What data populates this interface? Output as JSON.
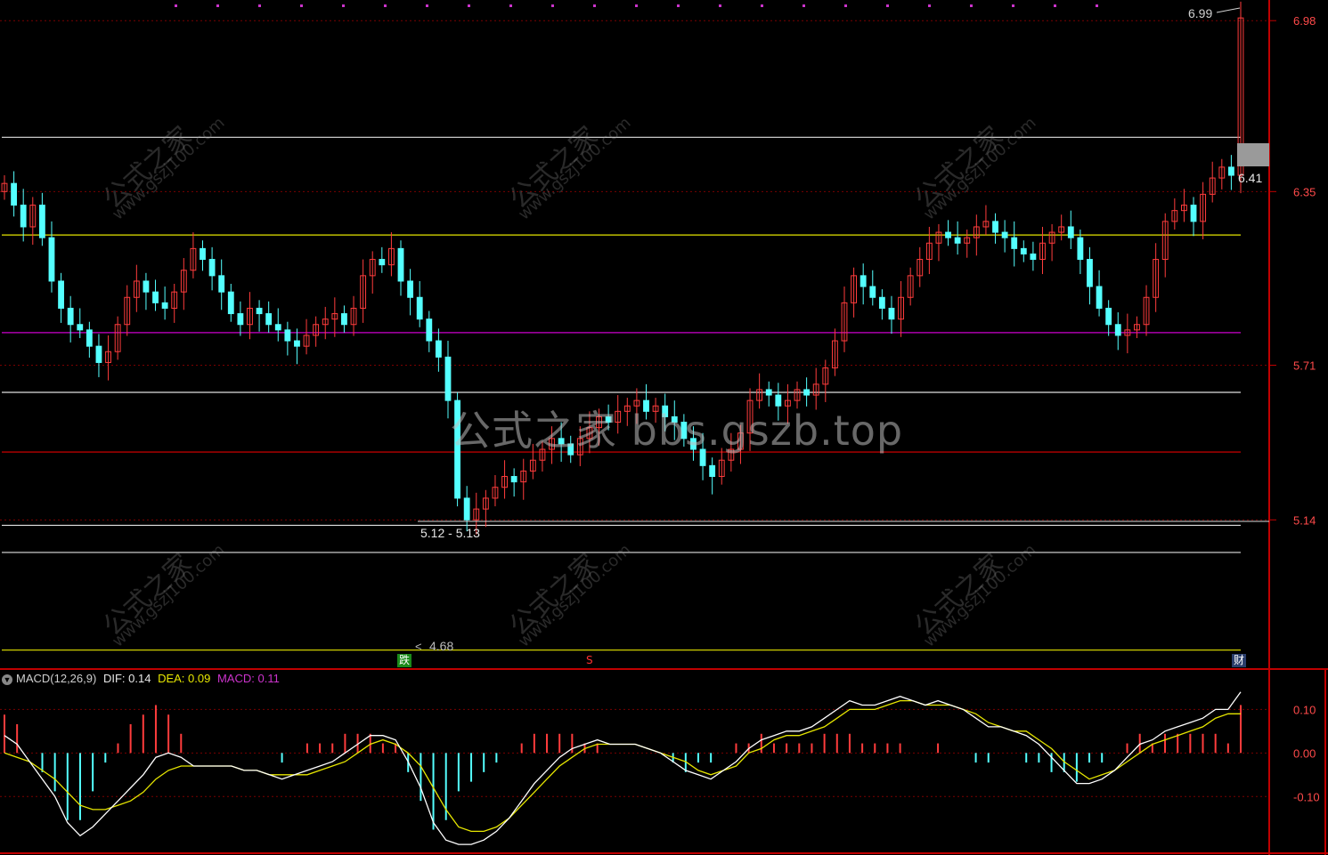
{
  "indicator": {
    "name": "MACD(12,26,9)",
    "dif_label": "DIF:",
    "dif_value": "0.14",
    "dea_label": "DEA:",
    "dea_value": "0.09",
    "macd_label": "MACD:",
    "macd_value": "0.11"
  },
  "watermark": {
    "main": "公式之家 bbs.gszb.top",
    "brand": "公式之家",
    "url": "www.gszj100.com"
  },
  "badges": {
    "drop": "跌",
    "s_mark": "S",
    "finance": "财"
  },
  "colors": {
    "up": "#ff3c3c",
    "down": "#54ffff",
    "axis": "#c00000",
    "grid": "#7a0000",
    "white_line": "#e0e0e0",
    "yellow_line": "#e6e600",
    "purple_line": "#cc00cc",
    "red_line": "#e00000",
    "dif": "#ffffff",
    "dea": "#e6e600"
  },
  "chart_data": {
    "type": "candlestick",
    "price_axis": {
      "ticks": [
        "6.98",
        "6.35",
        "5.71",
        "5.14"
      ],
      "range": [
        4.6,
        7.02
      ]
    },
    "macd_axis": {
      "ticks": [
        "0.10",
        "0.00",
        "-0.10"
      ],
      "range": [
        -0.22,
        0.16
      ]
    },
    "annotations": {
      "high_label": "6.99",
      "last_label": "6.41",
      "gap_label": "5.12 - 5.13",
      "low_label": "4.68"
    },
    "horizontal_lines": [
      {
        "price": 6.55,
        "color": "white_line"
      },
      {
        "price": 6.19,
        "color": "yellow_line"
      },
      {
        "price": 5.83,
        "color": "purple_line"
      },
      {
        "price": 5.61,
        "color": "white_line"
      },
      {
        "price": 5.39,
        "color": "red_line"
      },
      {
        "price": 5.12,
        "color": "white_line"
      },
      {
        "price": 5.02,
        "color": "white_line"
      },
      {
        "price": 4.66,
        "color": "yellow_line"
      }
    ],
    "close_series": [
      6.38,
      6.3,
      6.22,
      6.3,
      6.18,
      6.02,
      5.92,
      5.86,
      5.84,
      5.78,
      5.72,
      5.76,
      5.86,
      5.96,
      6.02,
      5.98,
      5.94,
      5.92,
      5.98,
      6.06,
      6.14,
      6.1,
      6.04,
      5.98,
      5.9,
      5.86,
      5.92,
      5.9,
      5.86,
      5.84,
      5.8,
      5.78,
      5.82,
      5.86,
      5.88,
      5.9,
      5.86,
      5.92,
      6.04,
      6.1,
      6.08,
      6.14,
      6.02,
      5.96,
      5.88,
      5.8,
      5.74,
      5.58,
      5.22,
      5.14,
      5.18,
      5.22,
      5.26,
      5.3,
      5.28,
      5.32,
      5.36,
      5.4,
      5.44,
      5.42,
      5.38,
      5.44,
      5.48,
      5.52,
      5.5,
      5.54,
      5.56,
      5.58,
      5.54,
      5.56,
      5.52,
      5.5,
      5.44,
      5.4,
      5.34,
      5.3,
      5.36,
      5.4,
      5.46,
      5.58,
      5.62,
      5.6,
      5.56,
      5.58,
      5.62,
      5.6,
      5.64,
      5.7,
      5.8,
      5.94,
      6.04,
      6.0,
      5.96,
      5.92,
      5.88,
      5.96,
      6.04,
      6.1,
      6.16,
      6.2,
      6.18,
      6.16,
      6.18,
      6.22,
      6.24,
      6.2,
      6.18,
      6.14,
      6.12,
      6.1,
      6.16,
      6.2,
      6.22,
      6.18,
      6.1,
      6.0,
      5.92,
      5.86,
      5.82,
      5.84,
      5.86,
      5.96,
      6.1,
      6.24,
      6.28,
      6.3,
      6.24,
      6.34,
      6.4,
      6.44,
      6.41,
      6.99
    ],
    "macd_dif": [
      0.04,
      0.02,
      -0.02,
      -0.06,
      -0.1,
      -0.16,
      -0.19,
      -0.17,
      -0.14,
      -0.11,
      -0.08,
      -0.05,
      -0.01,
      0.0,
      -0.01,
      -0.03,
      -0.03,
      -0.03,
      -0.03,
      -0.04,
      -0.04,
      -0.05,
      -0.06,
      -0.05,
      -0.04,
      -0.03,
      -0.02,
      0.0,
      0.02,
      0.04,
      0.04,
      0.03,
      -0.02,
      -0.08,
      -0.16,
      -0.2,
      -0.21,
      -0.21,
      -0.2,
      -0.18,
      -0.15,
      -0.11,
      -0.07,
      -0.04,
      -0.01,
      0.01,
      0.02,
      0.03,
      0.02,
      0.02,
      0.02,
      0.01,
      0.0,
      -0.02,
      -0.04,
      -0.05,
      -0.06,
      -0.04,
      -0.02,
      0.01,
      0.03,
      0.04,
      0.05,
      0.05,
      0.06,
      0.08,
      0.1,
      0.12,
      0.11,
      0.11,
      0.12,
      0.13,
      0.12,
      0.11,
      0.12,
      0.11,
      0.1,
      0.08,
      0.06,
      0.06,
      0.05,
      0.04,
      0.02,
      -0.01,
      -0.04,
      -0.07,
      -0.07,
      -0.06,
      -0.04,
      -0.01,
      0.02,
      0.03,
      0.05,
      0.06,
      0.07,
      0.08,
      0.1,
      0.1,
      0.14
    ],
    "macd_dea": [
      0.0,
      -0.01,
      -0.02,
      -0.04,
      -0.06,
      -0.09,
      -0.12,
      -0.13,
      -0.13,
      -0.12,
      -0.11,
      -0.09,
      -0.06,
      -0.04,
      -0.03,
      -0.03,
      -0.03,
      -0.03,
      -0.03,
      -0.04,
      -0.04,
      -0.05,
      -0.05,
      -0.05,
      -0.05,
      -0.04,
      -0.03,
      -0.02,
      0.0,
      0.02,
      0.03,
      0.02,
      0.0,
      -0.03,
      -0.08,
      -0.13,
      -0.17,
      -0.18,
      -0.18,
      -0.17,
      -0.15,
      -0.12,
      -0.09,
      -0.06,
      -0.03,
      -0.01,
      0.01,
      0.02,
      0.02,
      0.02,
      0.02,
      0.01,
      0.0,
      -0.01,
      -0.02,
      -0.04,
      -0.05,
      -0.04,
      -0.03,
      0.0,
      0.01,
      0.03,
      0.04,
      0.04,
      0.05,
      0.06,
      0.08,
      0.1,
      0.1,
      0.1,
      0.11,
      0.12,
      0.12,
      0.11,
      0.11,
      0.11,
      0.1,
      0.09,
      0.07,
      0.06,
      0.05,
      0.05,
      0.03,
      0.01,
      -0.02,
      -0.04,
      -0.06,
      -0.05,
      -0.04,
      -0.02,
      0.0,
      0.02,
      0.03,
      0.04,
      0.05,
      0.06,
      0.08,
      0.09,
      0.09
    ],
    "macd_hist": [
      0.04,
      0.03,
      0.0,
      -0.02,
      -0.04,
      -0.07,
      -0.07,
      -0.04,
      -0.01,
      0.01,
      0.03,
      0.04,
      0.05,
      0.04,
      0.02,
      0.0,
      0.0,
      0.0,
      0.0,
      0.0,
      0.0,
      0.0,
      -0.01,
      0.0,
      0.01,
      0.01,
      0.01,
      0.02,
      0.02,
      0.02,
      0.01,
      0.01,
      -0.02,
      -0.05,
      -0.08,
      -0.07,
      -0.04,
      -0.03,
      -0.02,
      -0.01,
      0.0,
      0.01,
      0.02,
      0.02,
      0.02,
      0.02,
      0.01,
      0.01,
      0.0,
      0.0,
      0.0,
      0.0,
      0.0,
      -0.01,
      -0.02,
      -0.01,
      -0.01,
      0.0,
      0.01,
      0.01,
      0.02,
      0.01,
      0.01,
      0.01,
      0.01,
      0.02,
      0.02,
      0.02,
      0.01,
      0.01,
      0.01,
      0.01,
      0.0,
      0.0,
      0.01,
      0.0,
      0.0,
      -0.01,
      -0.01,
      0.0,
      0.0,
      -0.01,
      -0.01,
      -0.02,
      -0.02,
      -0.03,
      -0.01,
      -0.01,
      0.0,
      0.01,
      0.02,
      0.01,
      0.02,
      0.02,
      0.02,
      0.02,
      0.02,
      0.01,
      0.05
    ]
  }
}
